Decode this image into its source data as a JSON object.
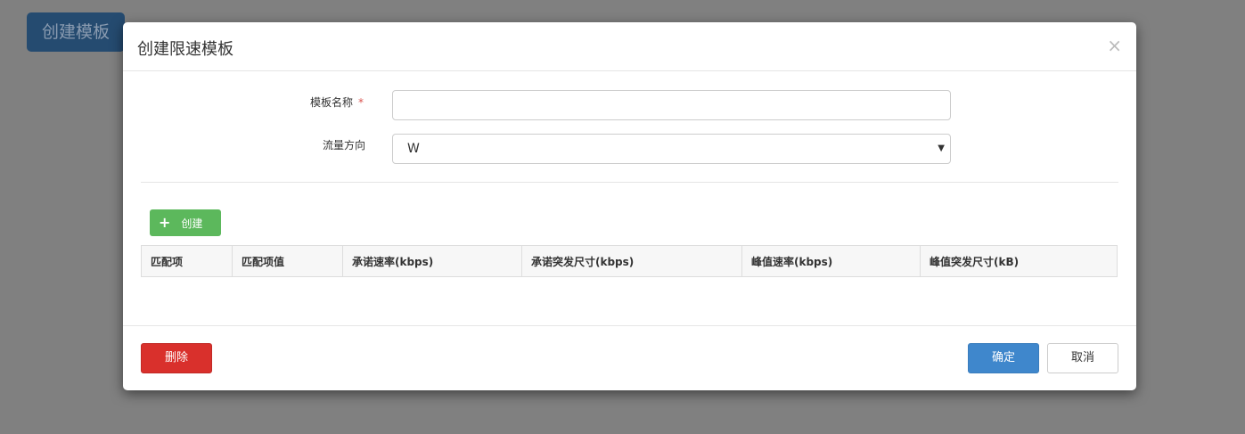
{
  "background_button": "创建模板",
  "modal": {
    "title": "创建限速模板",
    "close": "×",
    "fields": {
      "name_label": "模板名称",
      "required_mark": "*",
      "name_value": "",
      "direction_label": "流量方向",
      "direction_value": "W",
      "caret": "▼"
    },
    "add_button": {
      "icon": "+",
      "label": "创建"
    },
    "table": {
      "columns": [
        "匹配项",
        "匹配项值",
        "承诺速率(kbps)",
        "承诺突发尺寸(kbps)",
        "峰值速率(kbps)",
        "峰值突发尺寸(kB)"
      ]
    },
    "footer": {
      "delete": "删除",
      "confirm": "确定",
      "cancel": "取消"
    },
    "colors": {
      "success": "#5cb85c",
      "danger": "#d9302c",
      "primary": "#3f87cc"
    }
  }
}
